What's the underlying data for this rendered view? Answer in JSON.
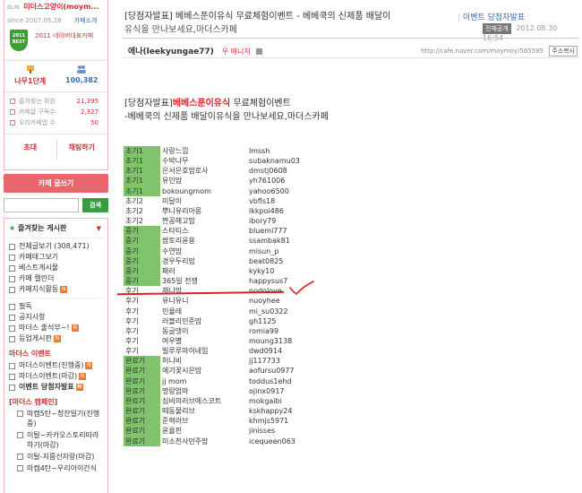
{
  "sidebar": {
    "cafe_small": "BLIN",
    "cafe_name": "미더스고양이(moym...",
    "since": "since 2007.05.28",
    "cafe_intro": "카페소개",
    "award_badge": "2011 BEST",
    "award_label": "2011 네이버대표카페",
    "level": "나무1단계",
    "members": "100,382",
    "meta": [
      {
        "label": "즐겨찾는 회원",
        "value": "21,395"
      },
      {
        "label": "카페글 구독수",
        "value": "2,327"
      },
      {
        "label": "우리카페앱 수",
        "value": "50"
      }
    ],
    "invite_label": "초대",
    "chat_label": "채팅하기",
    "write_label": "카페 글쓰기",
    "search_placeholder": "",
    "search_label": "검색",
    "fav_boards_label": "즐겨찾는 게시판",
    "board_items": [
      {
        "label": "전체글보기 (308,471)",
        "new": false,
        "bold": false
      },
      {
        "label": "카페태그보기",
        "new": false,
        "bold": false
      },
      {
        "label": "베스트게시물",
        "new": false,
        "bold": false
      },
      {
        "label": "카페 캘린더",
        "new": false,
        "bold": false
      },
      {
        "label": "카페지식활동",
        "new": true,
        "bold": false
      }
    ],
    "board_items2": [
      {
        "label": "필독",
        "new": false,
        "bold": false
      },
      {
        "label": "공지사항",
        "new": false,
        "bold": false
      },
      {
        "label": "마더스 출석부~!",
        "new": true,
        "bold": false
      },
      {
        "label": "등업게시판",
        "new": true,
        "bold": false
      }
    ],
    "event_cat": "마더스 이벤트",
    "event_items": [
      {
        "label": "마더스이벤트(진행중)",
        "new": true,
        "bold": false
      },
      {
        "label": "마더스이벤트(마감)",
        "new": true,
        "bold": false
      },
      {
        "label": "이벤트 당첨자발표",
        "new": true,
        "bold": true
      }
    ],
    "campaign_cat": "[마더스 캠페인]",
    "campaign_items": [
      "마캠5탄~청찬일기(진행중)",
      "이탈~카카오스토리따라하기(마감)",
      "이탈-지름신자랑(마감)",
      "마캠4탄~우리아이간식"
    ]
  },
  "post": {
    "title_tag": "[당첨자발표]",
    "title_main": "베베스푼이유식 무료체험이벤트 - 베베쿡의 신제품 배달이",
    "title_cont": "유식을 만나보세요,마더스카페",
    "category": "이벤트 당첨자발표",
    "full_badge": "전체공개",
    "date": "2012.08.30 16:54",
    "author_nick": "에나(leekyungae77)",
    "author_grade": "우 매니저",
    "url": "http://cafe.naver.com/moymoy/565595",
    "copy_label": "주소복사",
    "body_tag": "[당첨자발표]",
    "body_red": "베베스푼이유식",
    "body_rest": "무료체험이벤트",
    "body_line2": "-베베쿡의 신제품 배달이유식을 만나보세요,마더스카페"
  },
  "winners": [
    {
      "group": "초기1",
      "name": "사랑느낌",
      "id": "lmssh",
      "hl": true
    },
    {
      "group": "초기1",
      "name": "수박나무",
      "id": "subaknamu03",
      "hl": true
    },
    {
      "group": "초기1",
      "name": "은서은호맘로사",
      "id": "dmstj0608",
      "hl": true
    },
    {
      "group": "초기1",
      "name": "유민맘",
      "id": "yh761006",
      "hl": true
    },
    {
      "group": "초기1",
      "name": "bokoungmom",
      "id": "yahoo6500",
      "hl": true
    },
    {
      "group": "초기2",
      "name": "미달이",
      "id": "vbfls18",
      "hl": false
    },
    {
      "group": "초기2",
      "name": "뿌니유리아몽",
      "id": "lkkpoi486",
      "hl": false
    },
    {
      "group": "초기2",
      "name": "짠꽁해고맘",
      "id": "ibory79",
      "hl": false
    },
    {
      "group": "중기",
      "name": "스타티스",
      "id": "bluemi777",
      "hl": true
    },
    {
      "group": "중기",
      "name": "쌈토리윤용",
      "id": "ssambak81",
      "hl": true
    },
    {
      "group": "중기",
      "name": "수연맘",
      "id": "misun_p",
      "hl": true
    },
    {
      "group": "중기",
      "name": "경우두리맘",
      "id": "beat0825",
      "hl": true
    },
    {
      "group": "중기",
      "name": "패러",
      "id": "kyky10",
      "hl": true
    },
    {
      "group": "중기",
      "name": "365일 전쟁",
      "id": "happysus7",
      "hl": true
    },
    {
      "group": "후기",
      "name": "채니맘",
      "id": "nodolove",
      "hl": false
    },
    {
      "group": "후기",
      "name": "유니유니",
      "id": "nuoyhee",
      "hl": false
    },
    {
      "group": "후기",
      "name": "민율레",
      "id": "mi_su0322",
      "hl": false
    },
    {
      "group": "후기",
      "name": "러블리민준맘",
      "id": "gh1125",
      "hl": false
    },
    {
      "group": "후기",
      "name": "동글댕이",
      "id": "romia99",
      "hl": false
    },
    {
      "group": "후기",
      "name": "여우별",
      "id": "moung3138",
      "hl": false
    },
    {
      "group": "후기",
      "name": "빌루루마이네임",
      "id": "dwd0914",
      "hl": false
    },
    {
      "group": "완료기",
      "name": "허니비",
      "id": "jj117733",
      "hl": true
    },
    {
      "group": "완료기",
      "name": "애기꽃시은맘",
      "id": "aofursu0977",
      "hl": true
    },
    {
      "group": "완료기",
      "name": "jj mom",
      "id": "toddus1ehd",
      "hl": true
    },
    {
      "group": "완료기",
      "name": "명랑엄마",
      "id": "ojinx0917",
      "hl": true
    },
    {
      "group": "완료기",
      "name": "심비의러브에스코트",
      "id": "mokgaibi",
      "hl": true
    },
    {
      "group": "완료기",
      "name": "떼동물리브",
      "id": "kskhappy24",
      "hl": true
    },
    {
      "group": "완료기",
      "name": "준혁러브",
      "id": "khmjs5971",
      "hl": true
    },
    {
      "group": "완료기",
      "name": "윤율핀",
      "id": "jinisses",
      "hl": true
    },
    {
      "group": "완료기",
      "name": "미소천사민주맘",
      "id": "icequeen063",
      "hl": true
    }
  ],
  "colors": {
    "accent_red": "#e02020",
    "highlight_green": "#7fc46c",
    "sidebar_border": "#f0b8b8",
    "write_button": "#e8666c"
  }
}
